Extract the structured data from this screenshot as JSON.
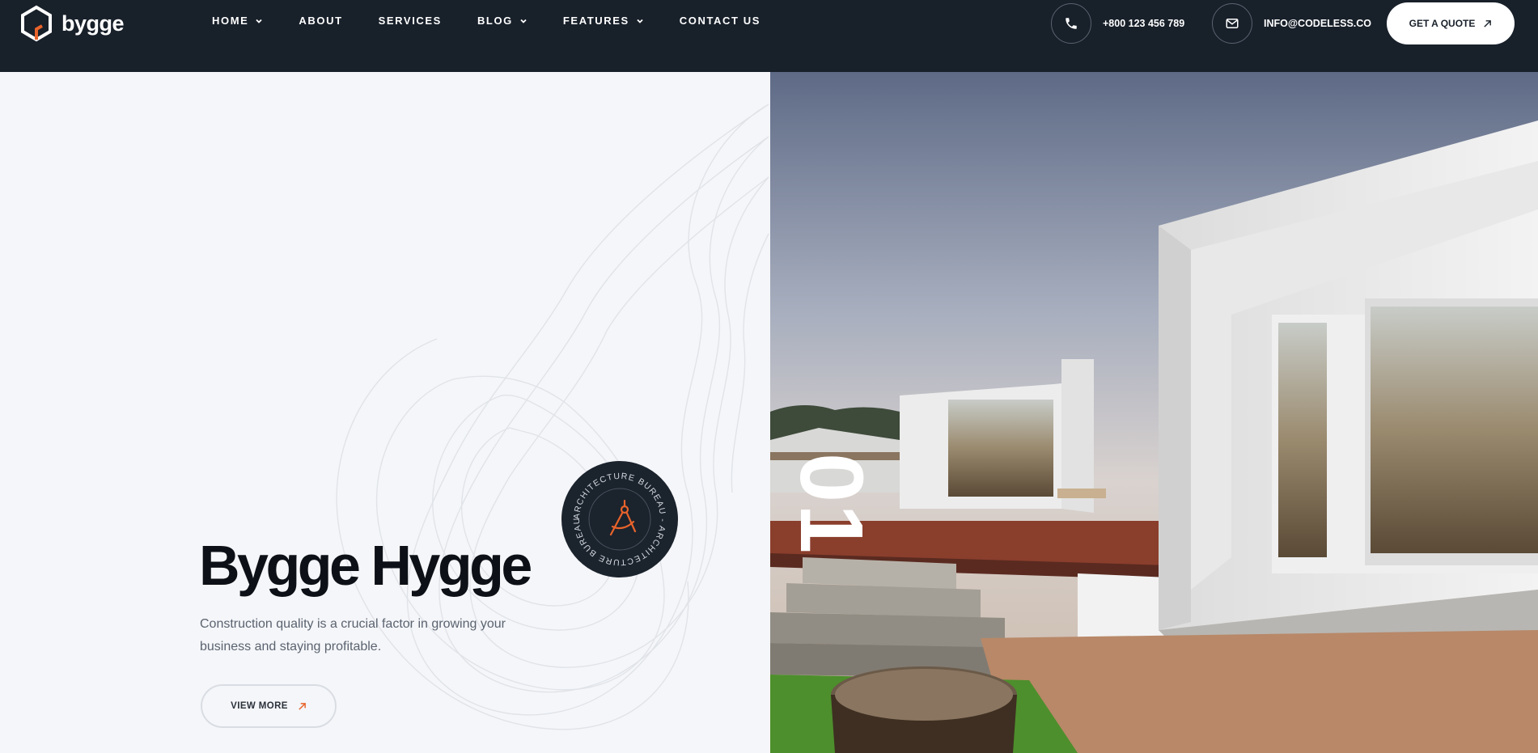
{
  "brand": {
    "name": "bygge",
    "accent": "#e8632b",
    "header_bg": "#18202a"
  },
  "nav": {
    "items": [
      {
        "label": "HOME",
        "dropdown": true
      },
      {
        "label": "ABOUT",
        "dropdown": false
      },
      {
        "label": "SERVICES",
        "dropdown": false
      },
      {
        "label": "BLOG",
        "dropdown": true
      },
      {
        "label": "FEATURES",
        "dropdown": true
      },
      {
        "label": "CONTACT US",
        "dropdown": false
      }
    ]
  },
  "contact": {
    "phone": "+800 123 456 789",
    "phone_icon": "phone-icon",
    "email": "INFO@CODELESS.CO",
    "email_icon": "mail-icon"
  },
  "cta": {
    "label": "GET A QUOTE",
    "icon": "arrow-up-right-icon"
  },
  "hero": {
    "title": "Bygge Hygge",
    "description": "Construction quality is a crucial factor in growing your business and staying profitable.",
    "button_label": "VIEW MORE",
    "badge_text": "ARCHITECTURE BUREAU  -  ARCHITECTURE BUREAU  -",
    "badge_icon": "drafting-compass-icon",
    "slide_number": "01"
  }
}
